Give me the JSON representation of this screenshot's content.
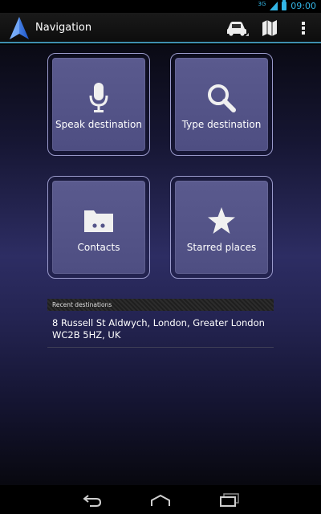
{
  "status_bar": {
    "network": "3G",
    "time": "09:00"
  },
  "action_bar": {
    "title": "Navigation",
    "icons": [
      "navigation-arrow-icon",
      "car-icon",
      "map-icon",
      "overflow-menu-icon"
    ]
  },
  "tiles": [
    {
      "label": "Speak destination",
      "icon": "microphone-icon"
    },
    {
      "label": "Type destination",
      "icon": "search-icon"
    },
    {
      "label": "Contacts",
      "icon": "contacts-folder-icon"
    },
    {
      "label": "Starred places",
      "icon": "star-icon"
    }
  ],
  "recent": {
    "header": "Recent destinations",
    "items": [
      {
        "address_line1": "8 Russell St Aldwych, London, Greater London",
        "address_line2": "WC2B 5HZ, UK"
      }
    ]
  },
  "nav_bar": {
    "icons": [
      "back-icon",
      "home-icon",
      "recent-apps-icon"
    ]
  },
  "colors": {
    "accent": "#33b5e5",
    "tile_fill": "#55558a",
    "tile_border": "#9a9acb"
  }
}
